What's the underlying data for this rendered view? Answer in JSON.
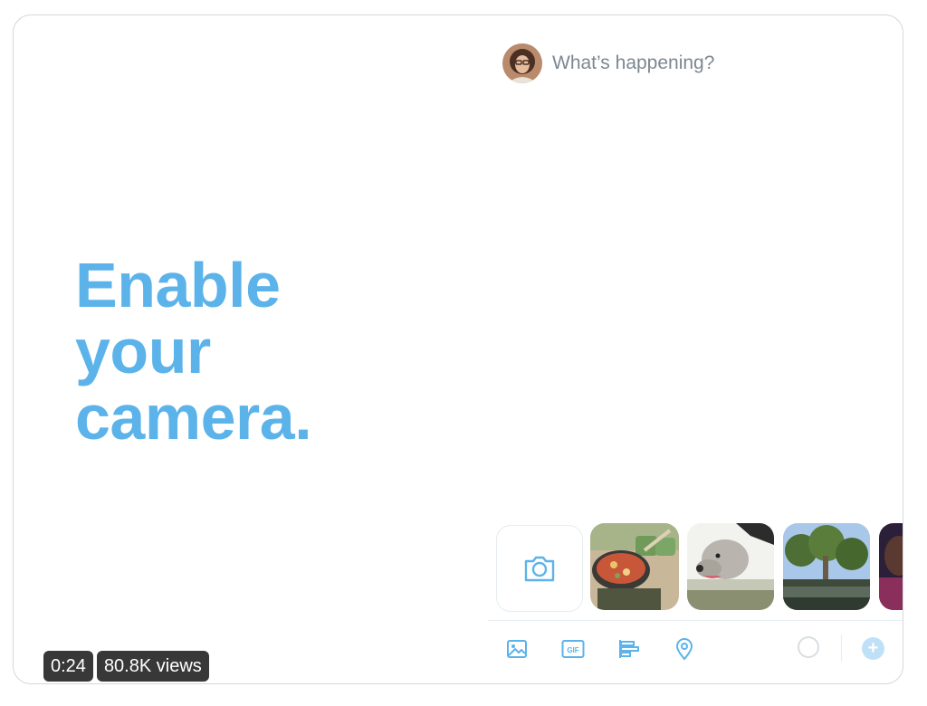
{
  "headline": {
    "line1": "Enable",
    "line2": "your",
    "line3": "camera."
  },
  "compose": {
    "placeholder": "What’s happening?"
  },
  "media_strip": {
    "camera_icon": "camera-icon",
    "thumbnails": [
      "food-pan-photo",
      "dog-photo",
      "crowd-trees-photo",
      "person-photo"
    ]
  },
  "toolbar": {
    "icons": [
      "image-icon",
      "gif-icon",
      "poll-icon",
      "location-icon"
    ],
    "gif_label": "GIF",
    "add_label": "+"
  },
  "video": {
    "duration": "0:24",
    "views": "80.8K views"
  },
  "colors": {
    "accent": "#5cb3ea",
    "accent_light": "#bfe1f7",
    "placeholder_text": "#7c8790",
    "border": "#d3d8dc"
  }
}
